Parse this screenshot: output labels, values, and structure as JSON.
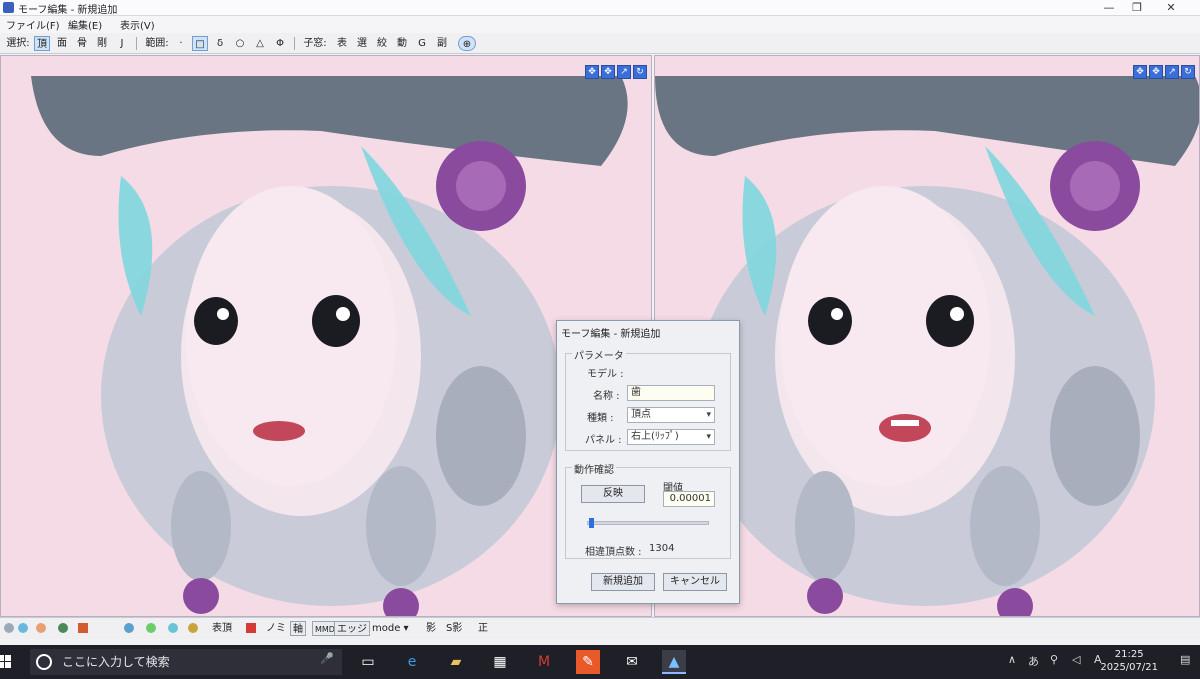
{
  "window": {
    "title": "モーフ編集 - 新規追加",
    "minimize": "—",
    "maximize": "❐",
    "close": "✕"
  },
  "menu": [
    "ファイル(F)",
    "編集(E)",
    "表示(V)"
  ],
  "toolbar": {
    "select_label": "選択:",
    "select_modes": [
      "頂",
      "面",
      "骨",
      "剛",
      "J"
    ],
    "range_label": "範囲:",
    "range_modes": [
      "·",
      "□",
      "δ",
      "○",
      "△",
      "Φ"
    ],
    "child_label": "子窓:",
    "child_windows": [
      "表",
      "選",
      "絞",
      "動",
      "G",
      "副"
    ]
  },
  "viewport_tools": [
    "✥",
    "✥",
    "↗",
    "↻"
  ],
  "dialog": {
    "title": "モーフ編集 - 新規追加",
    "param_group": "パラメータ",
    "model_label": "モデル :",
    "name_label": "名称 :",
    "name_value": "歯",
    "type_label": "種類 :",
    "type_value": "頂点",
    "panel_label": "パネル :",
    "panel_value": "右上(ﾘｯﾌﾟ)",
    "confirm_group": "動作確認",
    "invert_button": "反映",
    "threshold_label": "閾値",
    "threshold_value": "0.00001",
    "slider_value": 0.02,
    "diff_count_label": "相違頂点数 :",
    "diff_count_value": "1304",
    "add_button": "新規追加",
    "cancel_button": "キャンセル"
  },
  "bottombar": {
    "labels": [
      "表頂",
      "ノミ",
      "軸",
      "MMD",
      "エッジ",
      "mode",
      "影",
      "S影",
      "正"
    ]
  },
  "taskbar": {
    "search_placeholder": "ここに入力して検索",
    "time": "21:25",
    "date": "2025/07/21"
  }
}
